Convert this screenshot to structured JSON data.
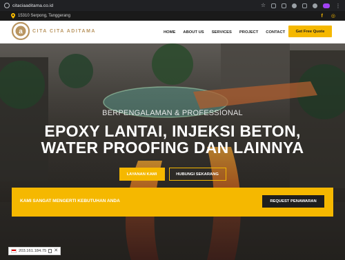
{
  "browser": {
    "url": "citaciaaditama.co.id"
  },
  "topbar": {
    "location": "15310 Serpong, Tanggerang",
    "facebook_glyph": "f",
    "instagram_glyph": "◎"
  },
  "header": {
    "logo_text": "CITA CITA ADITAMA",
    "nav": [
      "HOME",
      "ABOUT US",
      "SERVICES",
      "PROJECT",
      "CONTACT"
    ],
    "quote_button": "Get Free Quote"
  },
  "hero": {
    "tagline": "BERPENGALAMAN & PROFESSIONAL",
    "title_line1": "EPOXY LANTAI, INJEKSI BETON,",
    "title_line2": "WATER PROOFING DAN LAINNYA",
    "primary_button": "LAYANAN KAMI",
    "secondary_button": "HUBUNGI SEKARANG"
  },
  "cta": {
    "text": "KAMI SANGAT MENGERTI KEBUTUHAN ANDA",
    "button": "REQUEST PENAWARAN"
  },
  "overlay": {
    "ip": "203.161.184.75"
  },
  "colors": {
    "accent": "#f5b800",
    "dark": "#1a1a1a",
    "logo_gold": "#b99560"
  }
}
